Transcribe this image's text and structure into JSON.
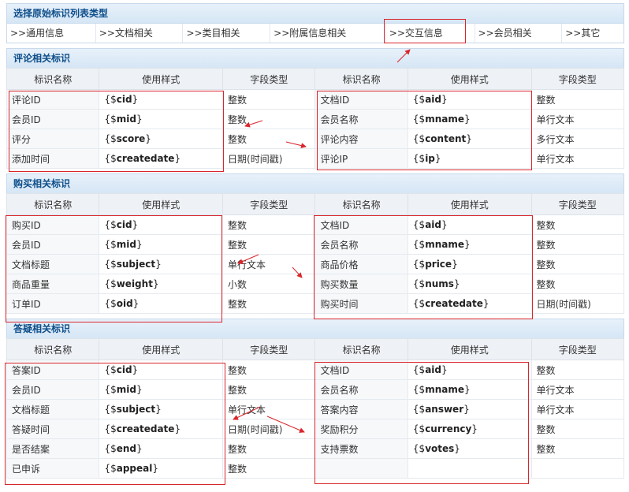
{
  "type_header": {
    "title": "选择原始标识列表类型",
    "items": [
      ">>通用信息",
      ">>文档相关",
      ">>类目相关",
      ">>附属信息相关",
      ">>交互信息",
      ">>会员相关",
      ">>其它"
    ]
  },
  "columns": [
    "标识名称",
    "使用样式",
    "字段类型",
    "标识名称",
    "使用样式",
    "字段类型"
  ],
  "sections": [
    {
      "title": "评论相关标识",
      "rows": [
        [
          "评论ID",
          "cid",
          "整数",
          "文档ID",
          "aid",
          "整数"
        ],
        [
          "会员ID",
          "mid",
          "整数",
          "会员名称",
          "mname",
          "单行文本"
        ],
        [
          "评分",
          "score",
          "整数",
          "评论内容",
          "content",
          "多行文本"
        ],
        [
          "添加时间",
          "createdate",
          "日期(时间戳)",
          "评论IP",
          "ip",
          "单行文本"
        ]
      ]
    },
    {
      "title": "购买相关标识",
      "rows": [
        [
          "购买ID",
          "cid",
          "整数",
          "文档ID",
          "aid",
          "整数"
        ],
        [
          "会员ID",
          "mid",
          "整数",
          "会员名称",
          "mname",
          "整数"
        ],
        [
          "文档标题",
          "subject",
          "单行文本",
          "商品价格",
          "price",
          "整数"
        ],
        [
          "商品重量",
          "weight",
          "小数",
          "购买数量",
          "nums",
          "整数"
        ],
        [
          "订单ID",
          "oid",
          "整数",
          "购买时间",
          "createdate",
          "日期(时间戳)"
        ]
      ]
    },
    {
      "title": "答疑相关标识",
      "rows": [
        [
          "答案ID",
          "cid",
          "整数",
          "文档ID",
          "aid",
          "整数"
        ],
        [
          "会员ID",
          "mid",
          "整数",
          "会员名称",
          "mname",
          "单行文本"
        ],
        [
          "文档标题",
          "subject",
          "单行文本",
          "答案内容",
          "answer",
          "单行文本"
        ],
        [
          "答疑时间",
          "createdate",
          "日期(时间戳)",
          "奖励积分",
          "currency",
          "整数"
        ],
        [
          "是否结案",
          "end",
          "整数",
          "支持票数",
          "votes",
          "整数"
        ],
        [
          "已申诉",
          "appeal",
          "整数",
          "",
          "",
          ""
        ]
      ]
    }
  ],
  "colors": {
    "accent": "#0e4e8a",
    "highlight": "#d9262c",
    "header_bg": "#d6e6f5"
  }
}
